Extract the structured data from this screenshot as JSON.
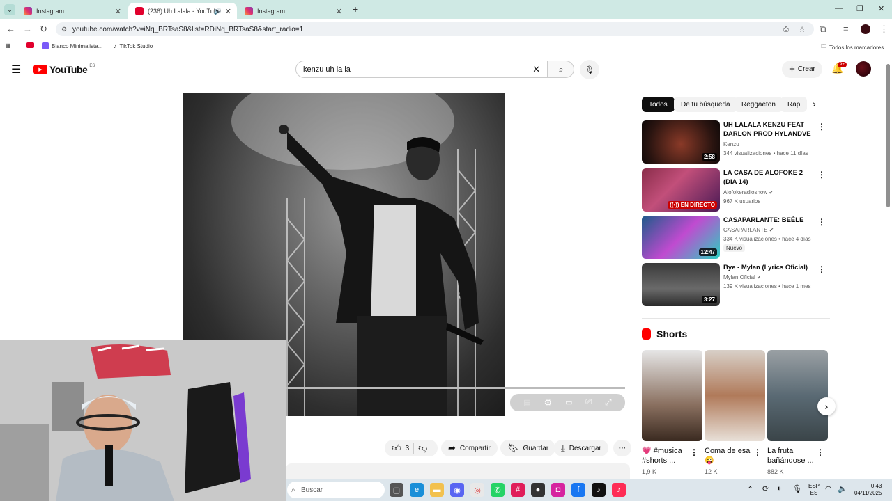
{
  "browser": {
    "tabs": [
      {
        "title": "Instagram"
      },
      {
        "title": "(236) Uh Lalala - YouTube"
      },
      {
        "title": "Instagram"
      }
    ],
    "url": "youtube.com/watch?v=iNq_BRTsaS8&list=RDiNq_BRTsaS8&start_radio=1",
    "bookmarks": [
      "Blanco Minimalista...",
      "TikTok Studio"
    ],
    "all_bookmarks": "Todos los marcadores"
  },
  "youtube": {
    "logo": "YouTube",
    "region": "ES",
    "search_value": "kenzu uh la la",
    "create_label": "Crear",
    "notif_badge": "9+"
  },
  "actions": {
    "likes": "3",
    "share": "Compartir",
    "save": "Guardar",
    "download": "Descargar"
  },
  "chips": [
    "Todos",
    "De tu búsqueda",
    "Reggaeton",
    "Rap"
  ],
  "recommended": [
    {
      "title": "UH LALALA KENZU FEAT DARLON PROD HYLANDVE",
      "channel": "Kenzu",
      "meta": "344 visualizaciones • hace 11 días",
      "duration": "2:58"
    },
    {
      "title": "LA CASA DE ALOFOKE 2 (DIA 14)",
      "channel": "Alofokeradioshow",
      "meta": "967 K usuarios",
      "live": "EN DIRECTO"
    },
    {
      "title": "CASAPARLANTE: BEÉLE",
      "channel": "CASAPARLANTE",
      "meta": "334 K visualizaciones • hace 4 días",
      "badge": "Nuevo",
      "duration": "12:47"
    },
    {
      "title": "Bye - Mylan (Lyrics Oficial)",
      "channel": "Mylan Oficial",
      "meta": "139 K visualizaciones • hace 1 mes",
      "duration": "3:27"
    }
  ],
  "shorts_heading": "Shorts",
  "shorts": [
    {
      "title": "💗 #musica #shorts ...",
      "views": "1,9 K"
    },
    {
      "title": "Coma de esa 😜",
      "views": "12 K"
    },
    {
      "title": "La fruta bañándose ...",
      "views": "882 K"
    }
  ],
  "taskbar": {
    "search_placeholder": "Buscar",
    "lang": "ESP",
    "lang2": "ES",
    "time": "0:43",
    "date": "04/11/2025"
  }
}
